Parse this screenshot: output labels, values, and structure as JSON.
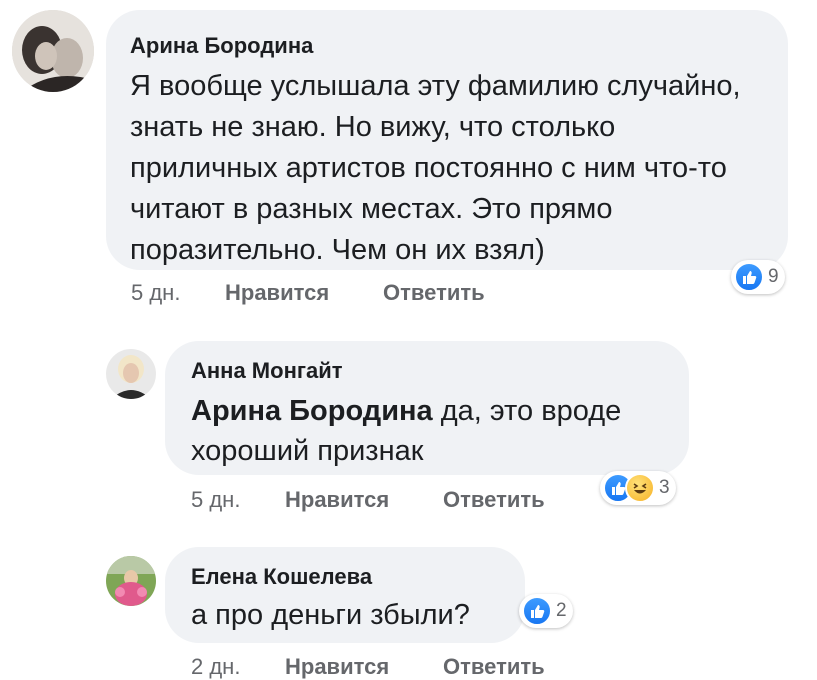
{
  "comments": [
    {
      "author": "Арина Бородина",
      "text": "Я вообще услышала эту фамилию случайно, знать не знаю. Но вижу, что столько приличных артистов постоянно с ним что-то читают в разных местах. Это прямо поразительно. Чем он их взял)",
      "time": "5 дн.",
      "like_label": "Нравится",
      "reply_label": "Ответить",
      "reactions": [
        "like-icon"
      ],
      "reaction_count": "9"
    },
    {
      "author": "Анна Монгайт",
      "mention": "Арина Бородина",
      "text": " да, это вроде хороший признак",
      "time": "5 дн.",
      "like_label": "Нравится",
      "reply_label": "Ответить",
      "reactions": [
        "like-icon",
        "haha-icon"
      ],
      "reaction_count": "3"
    },
    {
      "author": "Елена Кошелева",
      "text": "а про деньги збыли?",
      "time": "2 дн.",
      "like_label": "Нравится",
      "reply_label": "Ответить",
      "reactions": [
        "like-icon"
      ],
      "reaction_count": "2"
    }
  ]
}
